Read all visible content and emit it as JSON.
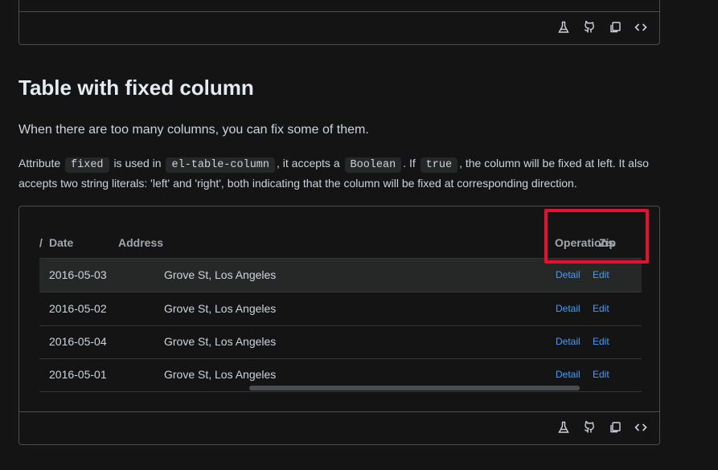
{
  "section": {
    "title": "Table with fixed column",
    "lead": "When there are too many columns, you can fix some of them.",
    "desc": {
      "t1": "Attribute",
      "c1": "fixed",
      "t2": "is used in",
      "c2": "el-table-column",
      "t3": ", it accepts a",
      "c3": "Boolean",
      "t4": ". If",
      "c4": "true",
      "t5": ", the column will be fixed at left. It also accepts two string literals: 'left' and 'right', both indicating that the column will be fixed at corresponding direction."
    }
  },
  "toolbar": {
    "icons": [
      "flask-icon",
      "github-icon",
      "copy-icon",
      "code-icon"
    ]
  },
  "table": {
    "headers": {
      "fixed_left_fragment": "/",
      "date": "Date",
      "address": "Address",
      "operations": "Operations",
      "zip": "Zip"
    },
    "rows": [
      {
        "date": "2016-05-03",
        "address": "Grove St, Los Angeles",
        "detail": "Detail",
        "edit": "Edit"
      },
      {
        "date": "2016-05-02",
        "address": "Grove St, Los Angeles",
        "detail": "Detail",
        "edit": "Edit"
      },
      {
        "date": "2016-05-04",
        "address": "Grove St, Los Angeles",
        "detail": "Detail",
        "edit": "Edit"
      },
      {
        "date": "2016-05-01",
        "address": "Grove St, Los Angeles",
        "detail": "Detail",
        "edit": "Edit"
      }
    ]
  },
  "colors": {
    "background": "#141414",
    "link": "#409eff",
    "highlight": "#e8112d",
    "border": "#4c4d4f"
  }
}
